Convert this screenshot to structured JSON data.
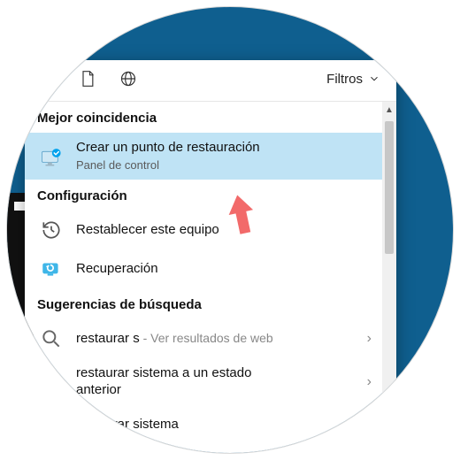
{
  "toolbar": {
    "filters_label": "Filtros"
  },
  "sections": {
    "best_match": "Mejor coincidencia",
    "settings": "Configuración",
    "search_suggestions": "Sugerencias de búsqueda"
  },
  "best_match_item": {
    "title": "Crear un punto de restauración",
    "subtitle": "Panel de control"
  },
  "settings_items": {
    "reset_pc": "Restablecer este equipo",
    "recovery": "Recuperación"
  },
  "suggestions": {
    "s1_primary": "restaurar s",
    "s1_secondary": " - Ver resultados de web",
    "s2_line1": "restaurar sistema a un estado",
    "s2_line2": "anterior",
    "s3": "restaurar sistema"
  }
}
